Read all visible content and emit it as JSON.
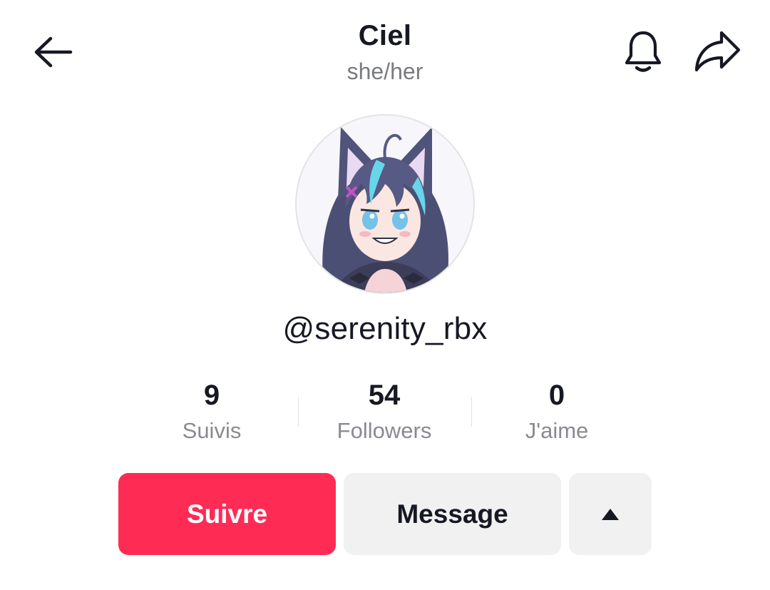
{
  "header": {
    "title": "Ciel",
    "pronouns": "she/her",
    "back_icon": "arrow-left-icon",
    "bell_icon": "bell-icon",
    "share_icon": "share-arrow-icon"
  },
  "profile": {
    "avatar_icon": "anime-wolf-girl-avatar",
    "username": "@serenity_rbx"
  },
  "stats": [
    {
      "value": "9",
      "label": "Suivis"
    },
    {
      "value": "54",
      "label": "Followers"
    },
    {
      "value": "0",
      "label": "J'aime"
    }
  ],
  "actions": {
    "follow_label": "Suivre",
    "message_label": "Message",
    "more_icon": "triangle-up-icon"
  },
  "colors": {
    "follow_bg": "#fe2c55",
    "secondary_bg": "#f1f1f2",
    "text_primary": "#161823",
    "text_secondary": "#8a8b91"
  }
}
